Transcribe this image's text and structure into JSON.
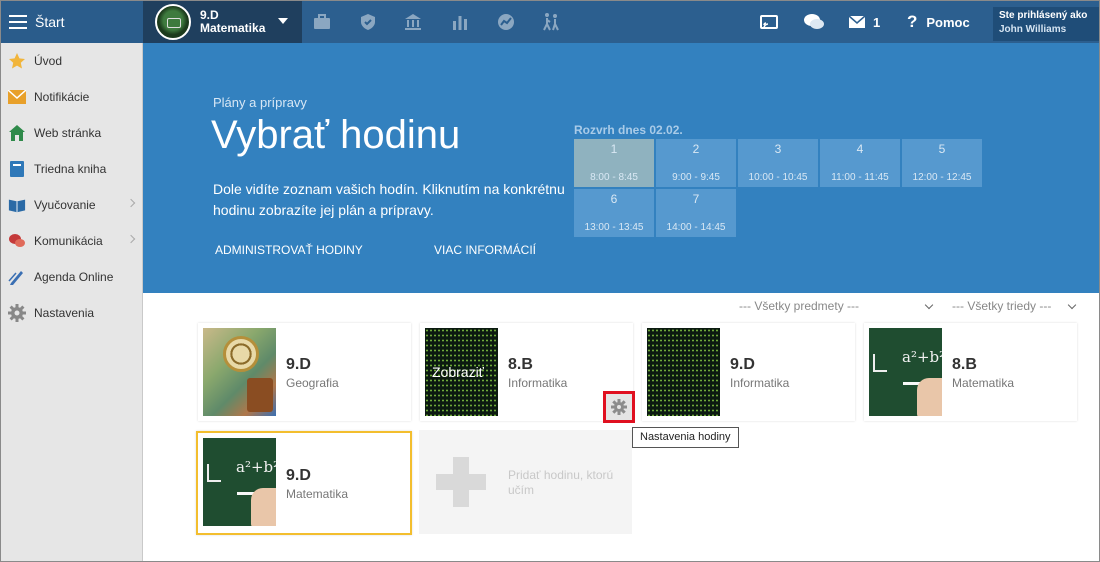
{
  "topbar": {
    "start_label": "Štart",
    "class_selector": {
      "class": "9.D",
      "subject": "Matematika"
    },
    "icons": [
      "briefcase-icon",
      "shield-icon",
      "bank-icon",
      "bar-chart-icon",
      "chart-circle-icon",
      "walking-people-icon"
    ],
    "cast_icon": "cast-icon",
    "chat_icon": "chat-icon",
    "mail_count": "1",
    "help_label": "Pomoc",
    "logged_in_label": "Ste prihlásený ako",
    "user_name": "John Williams"
  },
  "sidebar": {
    "items": [
      {
        "label": "Úvod",
        "icon": "star-icon",
        "has_chevron": false
      },
      {
        "label": "Notifikácie",
        "icon": "envelope-icon",
        "has_chevron": false
      },
      {
        "label": "Web stránka",
        "icon": "house-icon",
        "has_chevron": false
      },
      {
        "label": "Triedna kniha",
        "icon": "book-icon",
        "has_chevron": false
      },
      {
        "label": "Vyučovanie",
        "icon": "open-book-icon",
        "has_chevron": true
      },
      {
        "label": "Komunikácia",
        "icon": "speech-bubbles-icon",
        "has_chevron": true
      },
      {
        "label": "Agenda Online",
        "icon": "pen-icon",
        "has_chevron": false
      },
      {
        "label": "Nastavenia",
        "icon": "gear-icon",
        "has_chevron": false
      }
    ]
  },
  "hero": {
    "subtitle": "Plány a prípravy",
    "title": "Vybrať hodinu",
    "description": "Dole vidíte zoznam vašich hodín. Kliknutím na konkrétnu hodinu zobrazíte jej plán a prípravy.",
    "link_admin": "ADMINISTROVAŤ HODINY",
    "link_more": "VIAC INFORMÁCIÍ"
  },
  "schedule": {
    "title": "Rozvrh dnes 02.02.",
    "slots": [
      {
        "number": "1",
        "time": "8:00 - 8:45",
        "active": true
      },
      {
        "number": "2",
        "time": "9:00 - 9:45",
        "active": false
      },
      {
        "number": "3",
        "time": "10:00 - 10:45",
        "active": false
      },
      {
        "number": "4",
        "time": "11:00 - 11:45",
        "active": false
      },
      {
        "number": "5",
        "time": "12:00 - 12:45",
        "active": false
      },
      {
        "number": "6",
        "time": "13:00 - 13:45",
        "active": false
      },
      {
        "number": "7",
        "time": "14:00 - 14:45",
        "active": false
      }
    ]
  },
  "filters": {
    "subjects": "--- Všetky predmety ---",
    "classes": "--- Všetky triedy ---"
  },
  "lessons": [
    {
      "class": "9.D",
      "subject": "Geografia",
      "image": "geography",
      "overlay": ""
    },
    {
      "class": "8.B",
      "subject": "Informatika",
      "image": "matrix",
      "overlay": "Zobraziť"
    },
    {
      "class": "9.D",
      "subject": "Informatika",
      "image": "matrix",
      "overlay": ""
    },
    {
      "class": "8.B",
      "subject": "Matematika",
      "image": "chalkboard",
      "overlay": ""
    },
    {
      "class": "9.D",
      "subject": "Matematika",
      "image": "chalkboard",
      "overlay": "",
      "selected": true
    }
  ],
  "add_lesson_label": "Pridať hodinu, ktorú učím",
  "tooltip": "Nastavenia hodiny",
  "colors": {
    "topbar": "#2c5f8f",
    "hero": "#3381bf",
    "selected_border": "#f3be2e",
    "highlight": "#e01020"
  }
}
